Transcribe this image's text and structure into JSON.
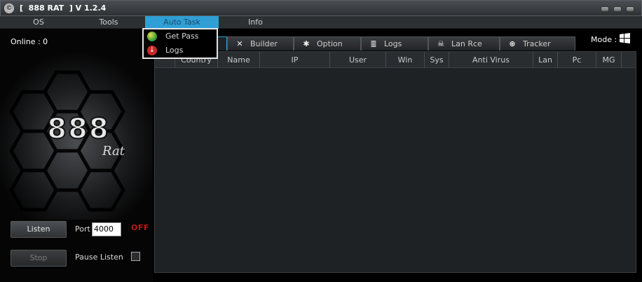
{
  "window": {
    "title": "[  888 RAT  ] V 1.2.4"
  },
  "menu": [
    "OS",
    "Tools",
    "Auto Task",
    "Info"
  ],
  "dropdown": {
    "items": [
      "Get Pass",
      "Logs"
    ]
  },
  "left": {
    "online": "Online : 0",
    "logo": {
      "big": "888",
      "small": "Rat"
    },
    "listen_label": "Listen",
    "port_label": "Port",
    "port_value": "4000",
    "status": "OFF",
    "stop_label": "Stop",
    "pause_label": "Pause Listen"
  },
  "mode_label": "Mode :",
  "tabs": [
    "Builder",
    "Option",
    "Logs",
    "Lan Rce",
    "Tracker"
  ],
  "columns": [
    "Country",
    "Name",
    "IP",
    "User",
    "Win",
    "Sys",
    "Anti Virus",
    "Lan",
    "Pc",
    "MG"
  ],
  "colors": {
    "accent": "#2f9fd6",
    "off": "#c0141c"
  }
}
